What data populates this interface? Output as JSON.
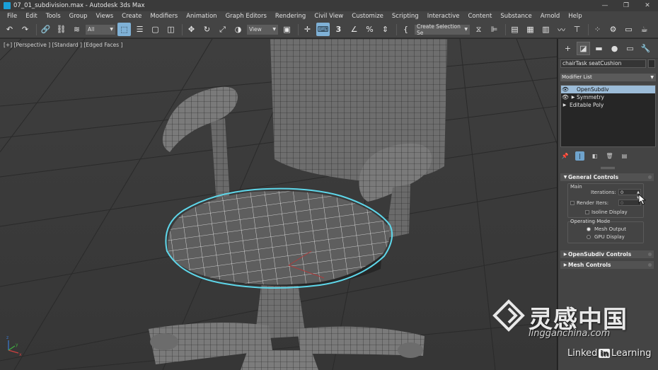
{
  "window": {
    "title": "07_01_subdivision.max - Autodesk 3ds Max",
    "controls": [
      "—",
      "❐",
      "✕"
    ]
  },
  "menubar": {
    "items": [
      "File",
      "Edit",
      "Tools",
      "Group",
      "Views",
      "Create",
      "Modifiers",
      "Animation",
      "Graph Editors",
      "Rendering",
      "Civil View",
      "Customize",
      "Scripting",
      "Interactive",
      "Content",
      "Substance",
      "Arnold",
      "Help"
    ]
  },
  "toolbar": {
    "selection_filter": "All",
    "reference_coord": "View",
    "named_selection_placeholder": "Create Selection Se",
    "snap_label": "3",
    "icons": [
      "undo-icon",
      "redo-icon",
      "link-icon",
      "unlink-icon",
      "bind-space-warp-icon",
      "select-object-icon",
      "select-by-name-icon",
      "rect-region-icon",
      "window-crossing-icon",
      "move-icon",
      "rotate-icon",
      "scale-icon",
      "place-icon",
      "pivot-icon",
      "manipulate-icon",
      "snaps-toggle-icon",
      "angle-snap-icon",
      "percent-snap-icon",
      "spinner-snap-icon",
      "edit-named-sets-icon",
      "mirror-icon",
      "align-icon",
      "scene-explorer-icon",
      "layer-explorer-icon",
      "ribbon-icon",
      "curve-editor-icon",
      "schematic-view-icon",
      "material-editor-icon",
      "render-setup-icon",
      "render-frame-icon",
      "render-icon"
    ]
  },
  "viewport": {
    "label": "[+] [Perspective ] [Standard ] [Edged Faces ]",
    "axis_labels": [
      "x",
      "y",
      "z"
    ]
  },
  "command_panel": {
    "tabs": [
      "create-tab-icon",
      "modify-tab-icon",
      "hierarchy-tab-icon",
      "motion-tab-icon",
      "display-tab-icon",
      "utilities-tab-icon"
    ],
    "object_name": "chairTask seatCushion",
    "modifier_list_label": "Modifier List",
    "modifier_stack": [
      {
        "label": "OpenSubdiv",
        "selected": true,
        "eye": true,
        "expand": false
      },
      {
        "label": "Symmetry",
        "selected": false,
        "eye": true,
        "expand": true
      },
      {
        "label": "Editable Poly",
        "selected": false,
        "eye": false,
        "expand": true
      }
    ],
    "general_controls": {
      "title": "General Controls",
      "main_label": "Main",
      "iterations_label": "Iterations:",
      "iterations_value": "0",
      "render_iters_label": "Render Iters:",
      "render_iters_value": "0",
      "isoline_label": "Isoline Display",
      "operating_mode_label": "Operating Mode",
      "mesh_output_label": "Mesh Output",
      "gpu_display_label": "GPU Display",
      "selected_mode": "Mesh Output"
    },
    "opensubdiv_controls_title": "OpenSubdiv Controls",
    "mesh_controls_title": "Mesh Controls"
  },
  "watermark": {
    "brand_cn": "灵感中国",
    "url": "lingganchina.com",
    "linkedin_pre": "Linked",
    "linkedin_in": "in",
    "linkedin_post": "Learning"
  }
}
